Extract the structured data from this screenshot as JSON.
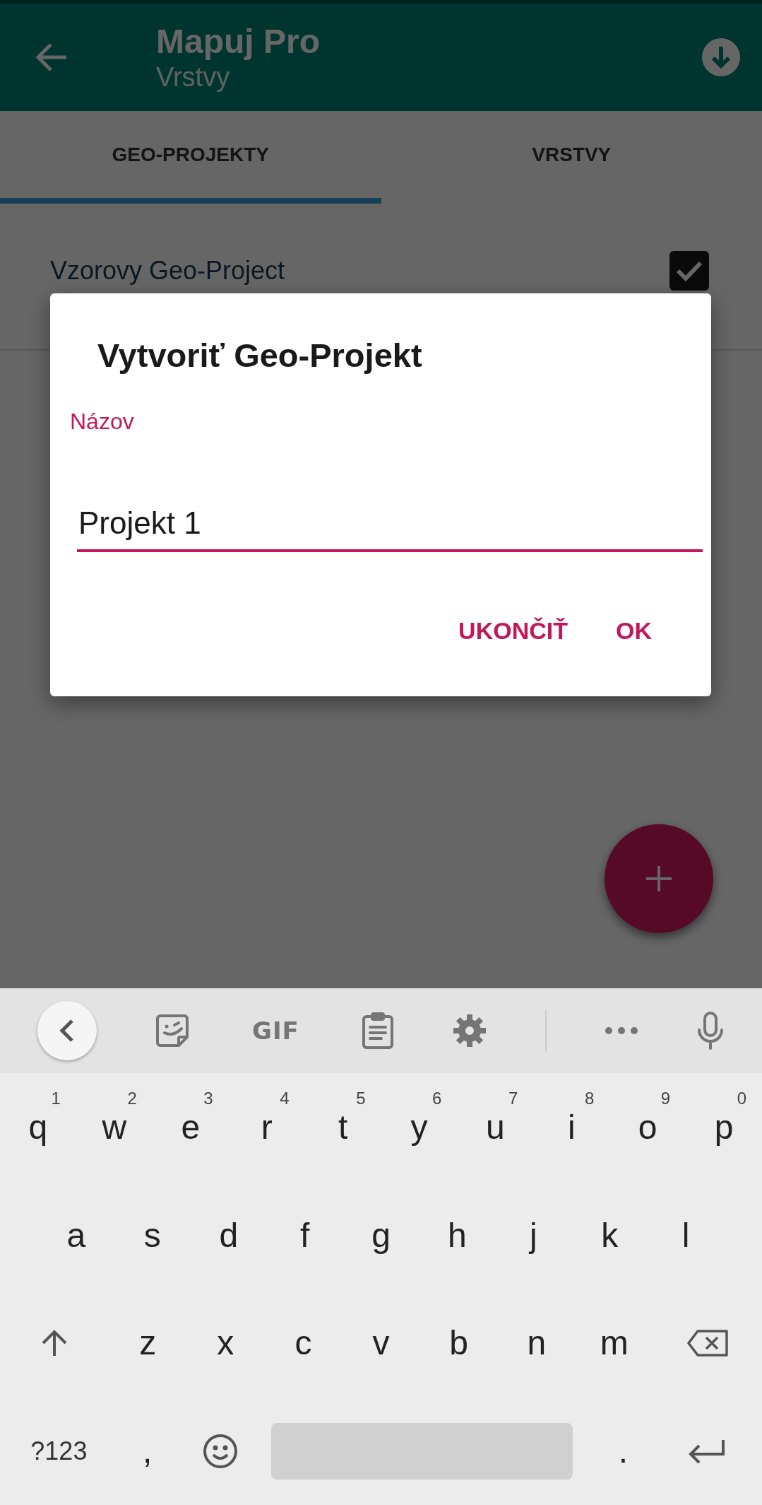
{
  "app_bar": {
    "title": "Mapuj Pro",
    "subtitle": "Vrstvy"
  },
  "tabs": [
    {
      "label": "GEO-PROJEKTY",
      "selected": true
    },
    {
      "label": "VRSTVY",
      "selected": false
    }
  ],
  "projects": [
    {
      "name": "Vzorovy Geo-Project",
      "checked": true
    }
  ],
  "dialog": {
    "title": "Vytvoriť Geo-Projekt",
    "field": {
      "label": "Názov",
      "value": "Projekt 1"
    },
    "buttons": [
      "UKONČIŤ",
      "OK"
    ]
  },
  "keyboard": {
    "toolbar": {
      "gif": "GIF"
    },
    "rows": [
      [
        {
          "kind": "letter",
          "label": "q",
          "hint": "1"
        },
        {
          "kind": "letter",
          "label": "w",
          "hint": "2"
        },
        {
          "kind": "letter",
          "label": "e",
          "hint": "3"
        },
        {
          "kind": "letter",
          "label": "r",
          "hint": "4"
        },
        {
          "kind": "letter",
          "label": "t",
          "hint": "5"
        },
        {
          "kind": "letter",
          "label": "y",
          "hint": "6"
        },
        {
          "kind": "letter",
          "label": "u",
          "hint": "7"
        },
        {
          "kind": "letter",
          "label": "i",
          "hint": "8"
        },
        {
          "kind": "letter",
          "label": "o",
          "hint": "9"
        },
        {
          "kind": "letter",
          "label": "p",
          "hint": "0"
        }
      ],
      [
        {
          "kind": "letter",
          "label": "a"
        },
        {
          "kind": "letter",
          "label": "s"
        },
        {
          "kind": "letter",
          "label": "d"
        },
        {
          "kind": "letter",
          "label": "f"
        },
        {
          "kind": "letter",
          "label": "g"
        },
        {
          "kind": "letter",
          "label": "h"
        },
        {
          "kind": "letter",
          "label": "j"
        },
        {
          "kind": "letter",
          "label": "k"
        },
        {
          "kind": "letter",
          "label": "l"
        }
      ],
      [
        {
          "kind": "shift"
        },
        {
          "kind": "letter",
          "label": "z"
        },
        {
          "kind": "letter",
          "label": "x"
        },
        {
          "kind": "letter",
          "label": "c"
        },
        {
          "kind": "letter",
          "label": "v"
        },
        {
          "kind": "letter",
          "label": "b"
        },
        {
          "kind": "letter",
          "label": "n"
        },
        {
          "kind": "letter",
          "label": "m"
        },
        {
          "kind": "backspace"
        }
      ],
      [
        {
          "kind": "symbols",
          "label": "?123"
        },
        {
          "kind": "letter",
          "label": ","
        },
        {
          "kind": "emoji"
        },
        {
          "kind": "space"
        },
        {
          "kind": "letter",
          "label": "."
        },
        {
          "kind": "enter"
        }
      ]
    ]
  }
}
